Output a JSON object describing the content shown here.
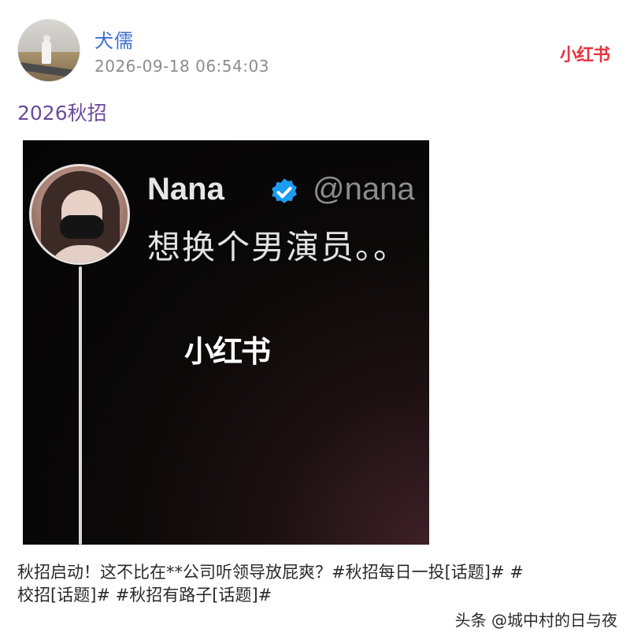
{
  "post": {
    "username": "犬儒",
    "timestamp": "2026-09-18  06:54:03",
    "brand_logo": "小红书",
    "title": "2026秋招",
    "body_line1": "秋招启动！这不比在**公司听领导放屁爽？#秋招每日一投[话题]#  #",
    "body_line2": "校招[话题]#  #秋招有路子[话题]#"
  },
  "media": {
    "tweet_name": "Nana",
    "tweet_handle": "@nana",
    "tweet_text": "想换个男演员。。",
    "watermark": "小红书",
    "verified_icon": "verified-badge-icon"
  },
  "footer": {
    "source": "头条 @城中村的日与夜"
  },
  "colors": {
    "username": "#3c6fd1",
    "title": "#6a4a9c",
    "brand": "#e8343f",
    "verified": "#1d9bf0"
  }
}
